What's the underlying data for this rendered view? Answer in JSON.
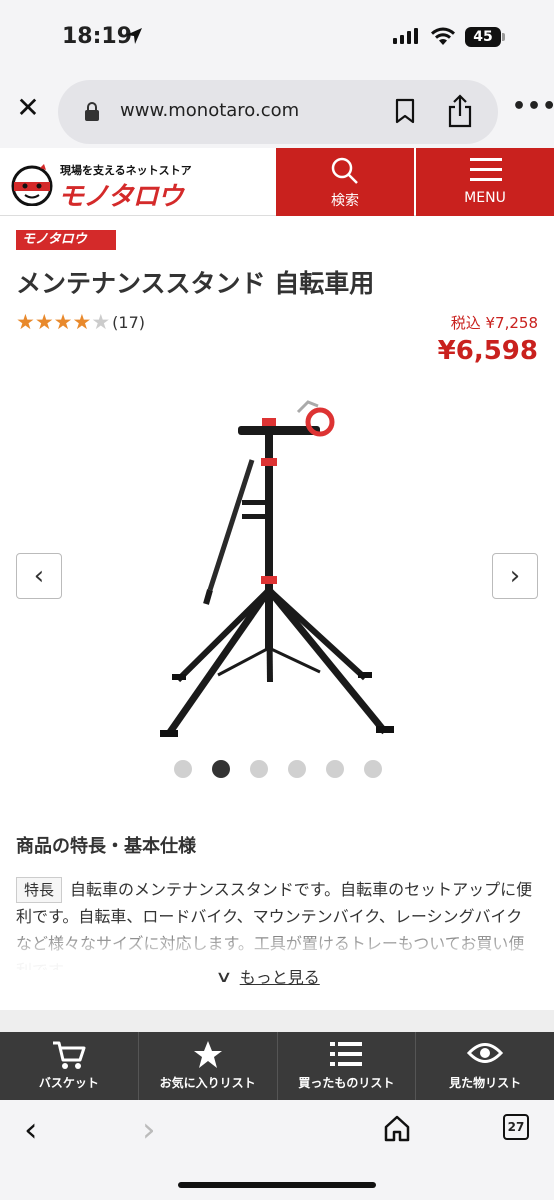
{
  "status": {
    "time": "18:19",
    "battery": "45"
  },
  "browser": {
    "url": "www.monotaro.com",
    "close_icon": "close-icon",
    "more_icon": "more-icon"
  },
  "header": {
    "tagline": "現場を支えるネットストア",
    "brand": "モノタロウ",
    "search_label": "検索",
    "menu_label": "MENU",
    "accent": "#c9211e"
  },
  "product": {
    "maker": "モノタロウ",
    "title": "メンテナンススタンド 自転車用",
    "rating": 4,
    "rating_max": 5,
    "review_count": "(17)",
    "tax_price": "税込 ¥7,258",
    "price": "¥6,598",
    "image_count": 6,
    "active_image": 2
  },
  "features": {
    "heading": "商品の特長・基本仕様",
    "badge": "特長",
    "text": "自転車のメンテナンススタンドです。自転車のセットアップに便利です。自転車、ロードバイク、マウンテンバイク、レーシングバイクなど様々なサイズに対応します。工具が置けるトレーもついてお買い便利です。",
    "more": "もっと見る"
  },
  "tabs": [
    {
      "label": "バスケット",
      "icon": "cart-icon"
    },
    {
      "label": "お気に入りリスト",
      "icon": "star-icon"
    },
    {
      "label": "買ったものリスト",
      "icon": "list-icon"
    },
    {
      "label": "見た物リスト",
      "icon": "eye-icon"
    }
  ],
  "toolbar": {
    "tab_count": "27"
  }
}
